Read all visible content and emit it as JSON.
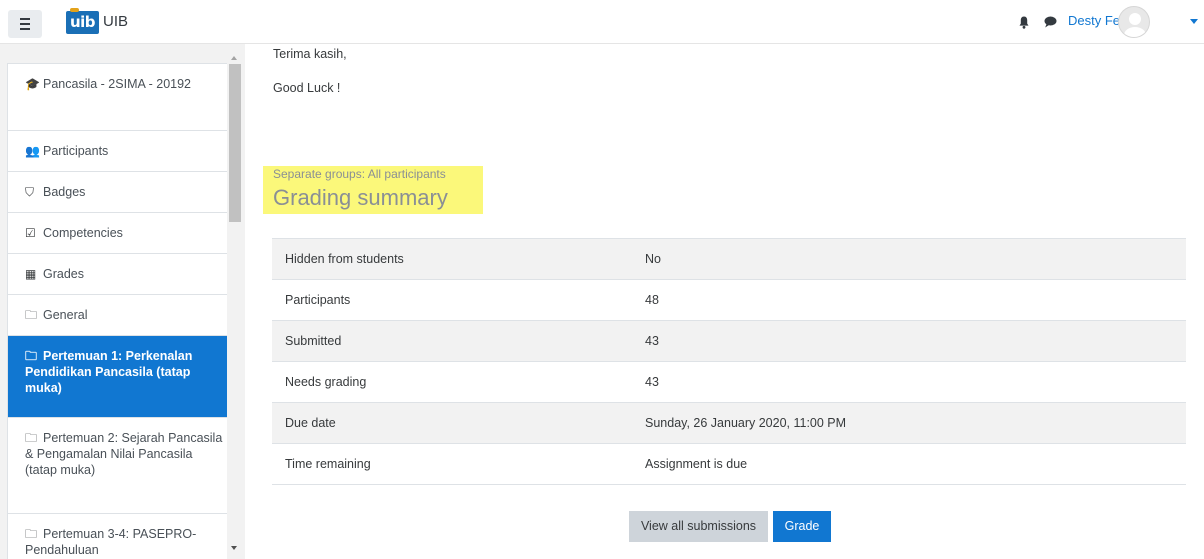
{
  "navbar": {
    "menu_icon": "hamburger-menu-icon",
    "logo_text": "uib",
    "site_name": "UIB",
    "notification_icon": "bell-icon",
    "messages_icon": "chat-bubble-icon",
    "user_name": "Desty Febria",
    "avatar_icon": "default-user-avatar-icon",
    "user_menu_icon": "caret-down-icon"
  },
  "drawer": {
    "items": [
      {
        "icon": "graduation-cap-icon",
        "glyph": "🎓",
        "label": "Pancasila - 2SIMA - 20192"
      },
      {
        "icon": "users-icon",
        "glyph": "👥",
        "label": "Participants"
      },
      {
        "icon": "shield-icon",
        "glyph": "⛉",
        "label": "Badges"
      },
      {
        "icon": "checkbox-icon",
        "glyph": "☑",
        "label": "Competencies"
      },
      {
        "icon": "table-icon",
        "glyph": "▦",
        "label": "Grades"
      },
      {
        "icon": "folder-icon",
        "glyph": "🗀",
        "label": "General"
      },
      {
        "icon": "folder-icon",
        "glyph": "🗀",
        "label": "Pertemuan 1: Perkenalan Pendidikan Pancasila (tatap muka)",
        "active": true
      },
      {
        "icon": "folder-icon",
        "glyph": "🗀",
        "label": "Pertemuan 2: Sejarah Pancasila & Pengamalan Nilai Pancasila (tatap muka)"
      },
      {
        "icon": "folder-icon",
        "glyph": "🗀",
        "label": "Pertemuan 3-4: PASEPRO-Pendahuluan"
      }
    ]
  },
  "main": {
    "closing_text": "Terima kasih,",
    "good_luck": "Good Luck !",
    "groups_label": "Separate groups: All participants",
    "heading": "Grading summary",
    "summary": [
      {
        "label": "Hidden from students",
        "value": "No"
      },
      {
        "label": "Participants",
        "value": "48"
      },
      {
        "label": "Submitted",
        "value": "43"
      },
      {
        "label": "Needs grading",
        "value": "43"
      },
      {
        "label": "Due date",
        "value": "Sunday, 26 January 2020, 11:00 PM"
      },
      {
        "label": "Time remaining",
        "value": "Assignment is due"
      }
    ],
    "view_all_button": "View all submissions",
    "grade_button": "Grade"
  },
  "colors": {
    "primary": "#1177d1",
    "highlight": "#fbf87a",
    "drawer_bg": "#f2f2f2"
  }
}
